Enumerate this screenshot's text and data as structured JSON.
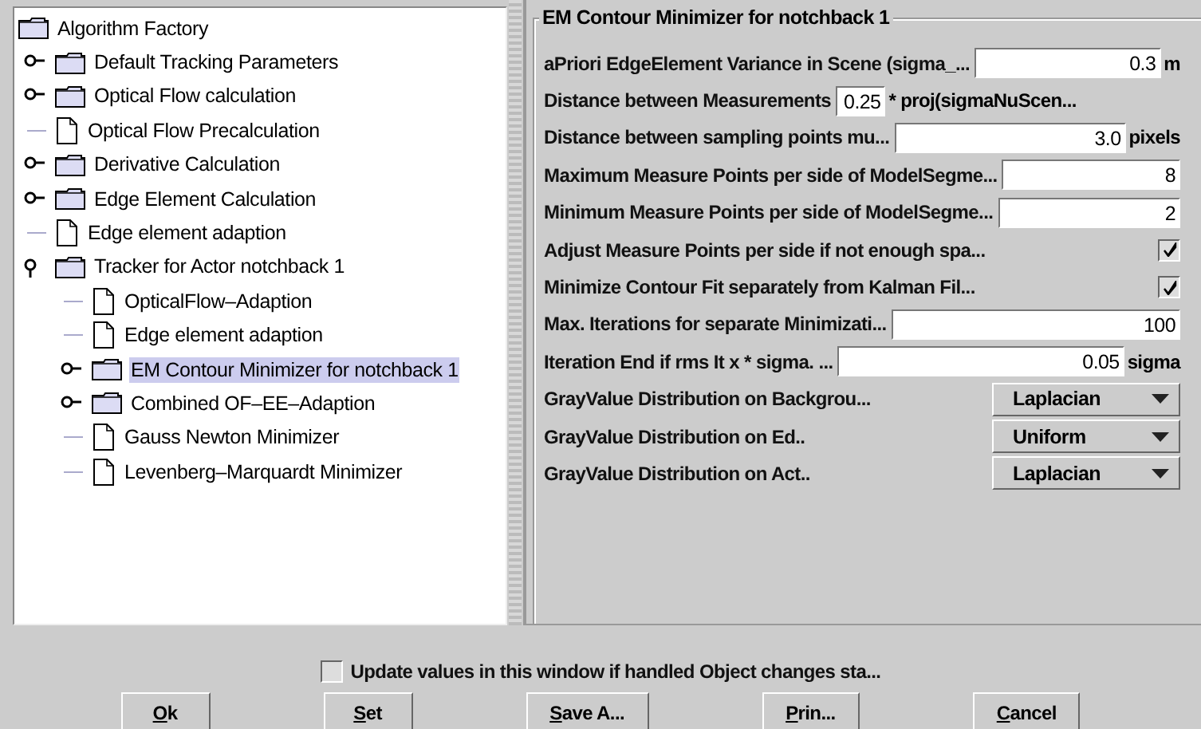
{
  "tree": {
    "label": "Algorithm Factory",
    "kind": "folder",
    "selected": false,
    "children": [
      {
        "label": "Default Tracking Parameters",
        "kind": "folder",
        "expanded": false,
        "selected": false
      },
      {
        "label": "Optical Flow calculation",
        "kind": "folder",
        "expanded": false,
        "selected": false
      },
      {
        "label": "Optical Flow Precalculation",
        "kind": "file",
        "selected": false
      },
      {
        "label": "Derivative Calculation",
        "kind": "folder",
        "expanded": false,
        "selected": false
      },
      {
        "label": "Edge Element Calculation",
        "kind": "folder",
        "expanded": false,
        "selected": false
      },
      {
        "label": "Edge element adaption",
        "kind": "file",
        "selected": false
      },
      {
        "label": "Tracker for Actor notchback 1",
        "kind": "folder",
        "expanded": true,
        "selected": false,
        "children": [
          {
            "label": "OpticalFlow–Adaption",
            "kind": "file",
            "selected": false
          },
          {
            "label": "Edge element adaption",
            "kind": "file",
            "selected": false
          },
          {
            "label": "EM Contour Minimizer for notchback 1",
            "kind": "folder",
            "expanded": false,
            "selected": true
          },
          {
            "label": "Combined OF–EE–Adaption",
            "kind": "folder",
            "expanded": false,
            "selected": false
          },
          {
            "label": "Gauss Newton Minimizer",
            "kind": "file",
            "selected": false
          },
          {
            "label": "Levenberg–Marquardt Minimizer",
            "kind": "file",
            "selected": false
          }
        ]
      }
    ]
  },
  "panel": {
    "title": "EM Contour Minimizer for notchback 1",
    "rows": [
      {
        "kind": "field",
        "label": "aPriori EdgeElement Variance in Scene (sigma_...",
        "value": "0.3",
        "unit": "m"
      },
      {
        "kind": "inline",
        "label": "Distance between Measurements",
        "value": "0.25",
        "unit": "* proj(sigmaNuScen..."
      },
      {
        "kind": "field",
        "label": "Distance between sampling points mu...",
        "value": "3.0",
        "unit": "pixels"
      },
      {
        "kind": "field",
        "label": "Maximum Measure Points per side of ModelSegme...",
        "value": "8"
      },
      {
        "kind": "field",
        "label": "Minimum Measure Points per side of ModelSegme...",
        "value": "2"
      },
      {
        "kind": "checkbox",
        "label": "Adjust Measure Points per side if not enough spa...",
        "checked": true
      },
      {
        "kind": "checkbox",
        "label": "Minimize Contour Fit separately from Kalman Fil...",
        "checked": true
      },
      {
        "kind": "field",
        "label": "Max. Iterations for separate Minimizati...",
        "value": "100"
      },
      {
        "kind": "field",
        "label": "Iteration End if rms It x * sigma. ...",
        "value": "0.05",
        "unit": "sigma"
      },
      {
        "kind": "dropdown",
        "label": "GrayValue Distribution on Backgrou...",
        "value": "Laplacian"
      },
      {
        "kind": "dropdown",
        "label": "GrayValue Distribution on Ed..",
        "value": "Uniform"
      },
      {
        "kind": "dropdown",
        "label": "GrayValue Distribution on Act..",
        "value": "Laplacian"
      }
    ]
  },
  "footer": {
    "checkbox": {
      "label": "Update values in this window if handled Object changes sta...",
      "checked": false
    },
    "buttons": [
      "Ok",
      "Set",
      "Save A...",
      "Prin...",
      "Cancel"
    ]
  }
}
